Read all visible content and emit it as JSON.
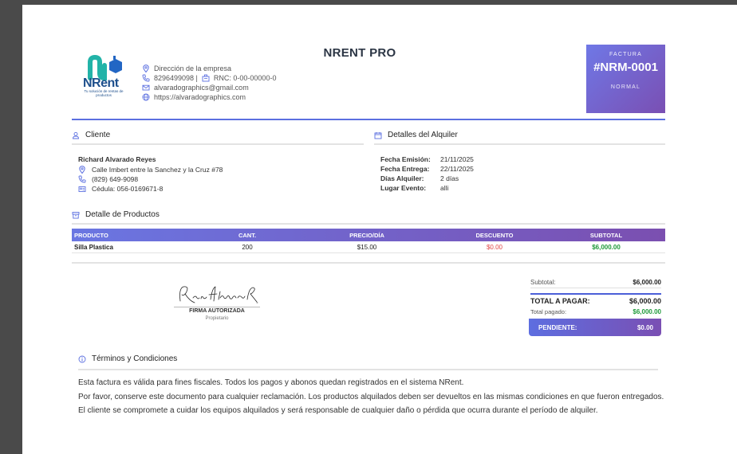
{
  "company": {
    "logo_text": "NRent",
    "logo_tagline": "Tu solución de rentas de productos",
    "name": "NRENT PRO",
    "address": "Dirección de la empresa",
    "phone": "8296499098 |",
    "rnc": "RNC: 0-00-00000-0",
    "email": "alvaradographics@gmail.com",
    "website": "https://alvaradographics.com"
  },
  "invoice": {
    "label": "FACTURA",
    "number": "#NRM-0001",
    "status": "NORMAL"
  },
  "client": {
    "section_title": "Cliente",
    "name": "Richard Alvarado Reyes",
    "address": "Calle Imbert entre la Sanchez y la Cruz #78",
    "phone": "(829) 649-9098",
    "id": "Cédula: 056-0169671-8"
  },
  "rental": {
    "section_title": "Detalles del Alquiler",
    "rows": [
      {
        "label": "Fecha Emisión:",
        "value": "21/11/2025"
      },
      {
        "label": "Fecha Entrega:",
        "value": "22/11/2025"
      },
      {
        "label": "Días Alquiler:",
        "value": "2 días"
      },
      {
        "label": "Lugar Evento:",
        "value": "alli"
      }
    ]
  },
  "products": {
    "section_title": "Detalle de Productos",
    "headers": [
      "PRODUCTO",
      "CANT.",
      "PRECIO/DÍA",
      "DESCUENTO",
      "SUBTOTAL"
    ],
    "rows": [
      {
        "product": "Silla Plastica",
        "qty": "200",
        "price": "$15.00",
        "discount": "$0.00",
        "subtotal": "$6,000.00"
      }
    ]
  },
  "signature": {
    "text": "Richard Alvarado R.",
    "label": "FIRMA AUTORIZADA",
    "role": "Propietario"
  },
  "totals": {
    "subtotal_label": "Subtotal:",
    "subtotal": "$6,000.00",
    "total_label": "TOTAL A PAGAR:",
    "total": "$6,000.00",
    "paid_label": "Total pagado:",
    "paid": "$6,000.00",
    "pending_label": "PENDIENTE:",
    "pending": "$0.00"
  },
  "terms": {
    "section_title": "Términos y Condiciones",
    "lines": [
      "Esta factura es válida para fines fiscales. Todos los pagos y abonos quedan registrados en el sistema NRent.",
      "Por favor, conserve este documento para cualquier reclamación. Los productos alquilados deben ser devueltos en las mismas condiciones en que fueron entregados.",
      "El cliente se compromete a cuidar los equipos alquilados y será responsable de cualquier daño o pérdida que ocurra durante el período de alquiler."
    ]
  },
  "colors": {
    "accent": "#5b6fe0",
    "accent_purple": "#7a4fb3",
    "discount_red": "#e04646",
    "subtotal_green": "#1f9a3a"
  }
}
